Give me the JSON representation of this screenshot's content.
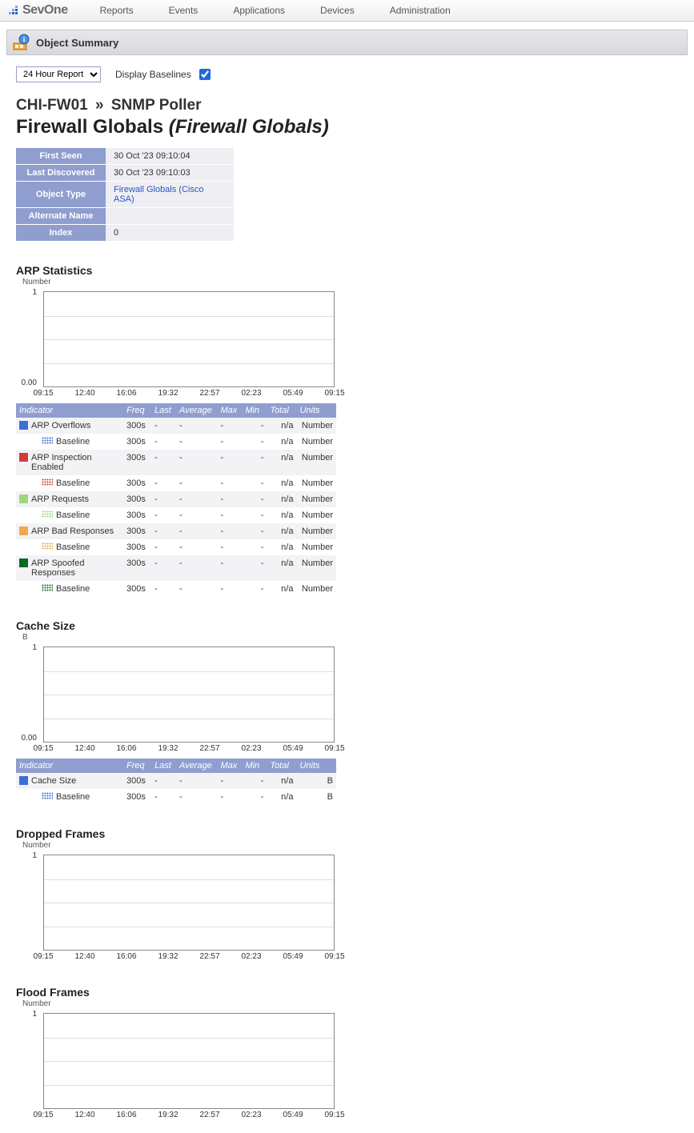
{
  "nav": {
    "brand": "SevOne",
    "items": [
      "Reports",
      "Events",
      "Applications",
      "Devices",
      "Administration"
    ]
  },
  "page": {
    "title": "Object Summary",
    "reportRange": "24 Hour Report",
    "displayBaselinesLabel": "Display Baselines",
    "displayBaselines": true,
    "breadcrumb": {
      "device": "CHI-FW01",
      "poller": "SNMP Poller"
    },
    "heading": "Firewall Globals",
    "headingParen": "(Firewall Globals)"
  },
  "info": [
    {
      "k": "First Seen",
      "v": "30 Oct '23 09:10:04",
      "link": false
    },
    {
      "k": "Last Discovered",
      "v": "30 Oct '23 09:10:03",
      "link": false
    },
    {
      "k": "Object Type",
      "v": "Firewall Globals (Cisco ASA)",
      "link": true
    },
    {
      "k": "Alternate Name",
      "v": "",
      "link": false
    },
    {
      "k": "Index",
      "v": "0",
      "link": false
    }
  ],
  "chartXTicks": [
    "09:15",
    "12:40",
    "16:06",
    "19:32",
    "22:57",
    "02:23",
    "05:49",
    "09:15"
  ],
  "tableHeaders": {
    "ind": "Indicator",
    "freq": "Freq",
    "last": "Last",
    "avg": "Average",
    "max": "Max",
    "min": "Min",
    "total": "Total",
    "units": "Units"
  },
  "baselineLabel": "Baseline",
  "panels": [
    {
      "title": "ARP Statistics",
      "sub": "Number",
      "ymax": "1",
      "ymin": "0.00",
      "units": "Number",
      "rows": [
        {
          "name": "ARP Overflows",
          "color": "#3a6fd8",
          "freq": "300s",
          "last": "-",
          "avg": "-",
          "max": "-",
          "min": "-",
          "total": "n/a",
          "baseline": {
            "freq": "300s",
            "last": "-",
            "avg": "-",
            "max": "-",
            "min": "-",
            "total": "n/a"
          }
        },
        {
          "name": "ARP Inspection Enabled",
          "color": "#d23b3b",
          "freq": "300s",
          "last": "-",
          "avg": "-",
          "max": "-",
          "min": "-",
          "total": "n/a",
          "baseline": {
            "freq": "300s",
            "last": "-",
            "avg": "-",
            "max": "-",
            "min": "-",
            "total": "n/a"
          }
        },
        {
          "name": "ARP Requests",
          "color": "#9fd67a",
          "freq": "300s",
          "last": "-",
          "avg": "-",
          "max": "-",
          "min": "-",
          "total": "n/a",
          "baseline": {
            "freq": "300s",
            "last": "-",
            "avg": "-",
            "max": "-",
            "min": "-",
            "total": "n/a"
          }
        },
        {
          "name": "ARP Bad Responses",
          "color": "#f0a94a",
          "freq": "300s",
          "last": "-",
          "avg": "-",
          "max": "-",
          "min": "-",
          "total": "n/a",
          "baseline": {
            "freq": "300s",
            "last": "-",
            "avg": "-",
            "max": "-",
            "min": "-",
            "total": "n/a"
          }
        },
        {
          "name": "ARP Spoofed Responses",
          "color": "#0a6b1e",
          "freq": "300s",
          "last": "-",
          "avg": "-",
          "max": "-",
          "min": "-",
          "total": "n/a",
          "baseline": {
            "freq": "300s",
            "last": "-",
            "avg": "-",
            "max": "-",
            "min": "-",
            "total": "n/a"
          }
        }
      ]
    },
    {
      "title": "Cache Size",
      "sub": "B",
      "ymax": "1",
      "ymin": "0.00",
      "units": "B",
      "rows": [
        {
          "name": "Cache Size",
          "color": "#3a6fd8",
          "freq": "300s",
          "last": "-",
          "avg": "-",
          "max": "-",
          "min": "-",
          "total": "n/a",
          "baseline": {
            "freq": "300s",
            "last": "-",
            "avg": "-",
            "max": "-",
            "min": "-",
            "total": "n/a"
          }
        }
      ]
    },
    {
      "title": "Dropped Frames",
      "sub": "Number",
      "ymax": "1",
      "ymin": "",
      "units": "Number",
      "rows": []
    },
    {
      "title": "Flood Frames",
      "sub": "Number",
      "ymax": "1",
      "ymin": "",
      "units": "Number",
      "rows": []
    }
  ],
  "chart_data": [
    {
      "type": "line",
      "title": "ARP Statistics",
      "ylabel": "Number",
      "ylim": [
        0,
        1
      ],
      "x": [
        "09:15",
        "12:40",
        "16:06",
        "19:32",
        "22:57",
        "02:23",
        "05:49",
        "09:15"
      ],
      "series": [
        {
          "name": "ARP Overflows",
          "values": []
        },
        {
          "name": "ARP Inspection Enabled",
          "values": []
        },
        {
          "name": "ARP Requests",
          "values": []
        },
        {
          "name": "ARP Bad Responses",
          "values": []
        },
        {
          "name": "ARP Spoofed Responses",
          "values": []
        }
      ]
    },
    {
      "type": "line",
      "title": "Cache Size",
      "ylabel": "B",
      "ylim": [
        0,
        1
      ],
      "x": [
        "09:15",
        "12:40",
        "16:06",
        "19:32",
        "22:57",
        "02:23",
        "05:49",
        "09:15"
      ],
      "series": [
        {
          "name": "Cache Size",
          "values": []
        }
      ]
    },
    {
      "type": "line",
      "title": "Dropped Frames",
      "ylabel": "Number",
      "ylim": [
        0,
        1
      ],
      "x": [
        "09:15",
        "12:40",
        "16:06",
        "19:32",
        "22:57",
        "02:23",
        "05:49",
        "09:15"
      ],
      "series": []
    },
    {
      "type": "line",
      "title": "Flood Frames",
      "ylabel": "Number",
      "ylim": [
        0,
        1
      ],
      "x": [
        "09:15",
        "12:40",
        "16:06",
        "19:32",
        "22:57",
        "02:23",
        "05:49",
        "09:15"
      ],
      "series": []
    }
  ]
}
